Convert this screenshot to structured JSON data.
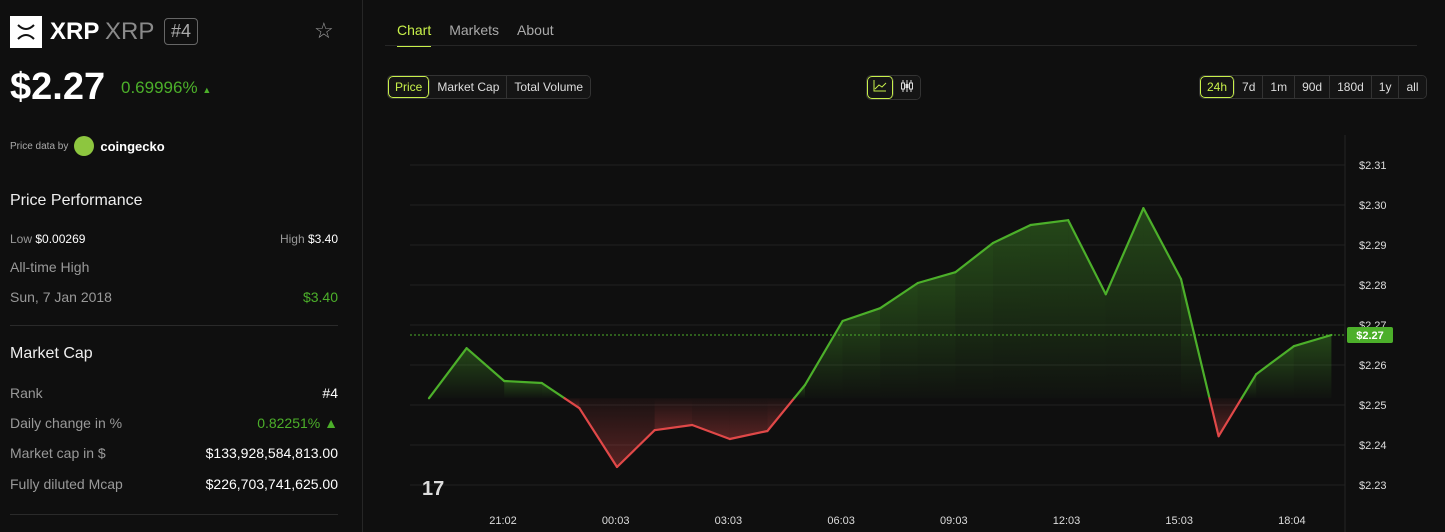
{
  "coin": {
    "name": "XRP",
    "symbol": "XRP",
    "rank": "#4",
    "price": "$2.27",
    "change": "0.69996%",
    "arrow": "▲"
  },
  "source": {
    "label": "Price data by",
    "provider": "coingecko"
  },
  "performance": {
    "title": "Price Performance",
    "low_label": "Low",
    "low": "$0.00269",
    "high_label": "High",
    "high": "$3.40",
    "ath_label": "All-time High",
    "ath_date": "Sun, 7 Jan 2018",
    "ath": "$3.40"
  },
  "market_cap": {
    "title": "Market Cap",
    "rows": [
      {
        "label": "Rank",
        "value": "#4"
      },
      {
        "label": "Daily change in %",
        "value": "0.82251% ▲"
      },
      {
        "label": "Market cap in $",
        "value": "$133,928,584,813.00"
      },
      {
        "label": "Fully diluted Mcap",
        "value": "$226,703,741,625.00"
      }
    ]
  },
  "tabs": [
    "Chart",
    "Markets",
    "About"
  ],
  "metrics": [
    "Price",
    "Market Cap",
    "Total Volume"
  ],
  "ranges": [
    "24h",
    "7d",
    "1m",
    "90d",
    "180d",
    "1y",
    "all"
  ],
  "colors": {
    "up": "#4caf2a",
    "down": "#e04848",
    "accent": "#c8f04a"
  },
  "chart_data": {
    "type": "line",
    "ylim": [
      2.225,
      2.315
    ],
    "yticks": [
      "$2.23",
      "$2.24",
      "$2.25",
      "$2.26",
      "$2.27",
      "$2.28",
      "$2.29",
      "$2.30",
      "$2.31"
    ],
    "xticks": [
      "21:02",
      "00:03",
      "03:03",
      "06:03",
      "09:03",
      "12:03",
      "15:03",
      "18:04"
    ],
    "current_label": "$2.27",
    "baseline": 2.2517,
    "values": [
      2.2517,
      2.2642,
      2.256,
      2.2555,
      2.2492,
      2.2345,
      2.2437,
      2.245,
      2.2415,
      2.2435,
      2.255,
      2.271,
      2.2742,
      2.2805,
      2.2832,
      2.2905,
      2.295,
      2.2962,
      2.2777,
      2.2992,
      2.2815,
      2.2422,
      2.2577,
      2.2647,
      2.2675
    ]
  }
}
